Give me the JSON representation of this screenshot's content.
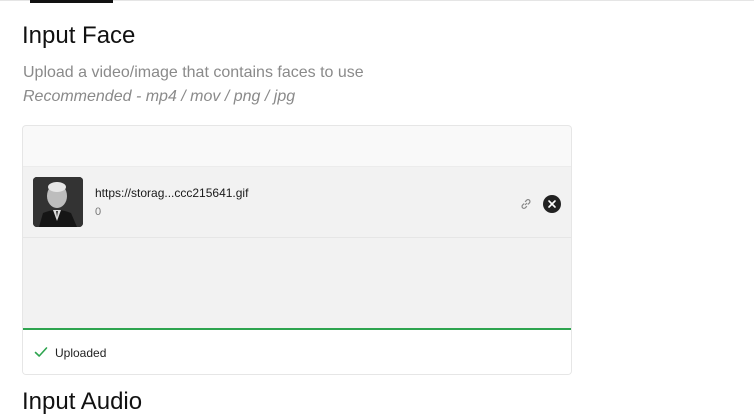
{
  "section": {
    "title": "Input Face",
    "description": "Upload a video/image that contains faces to use",
    "recommended": "Recommended - mp4 / mov / png / jpg"
  },
  "upload": {
    "file_name": "https://storag...ccc215641.gif",
    "file_size": "0",
    "status": "Uploaded",
    "progress": 1.0,
    "icons": {
      "link": "link-icon",
      "remove": "close-circle-icon",
      "status": "checkmark-icon"
    },
    "colors": {
      "accent": "#2ea44f",
      "remove_bg": "#222222"
    }
  },
  "next_section": {
    "title": "Input Audio"
  }
}
